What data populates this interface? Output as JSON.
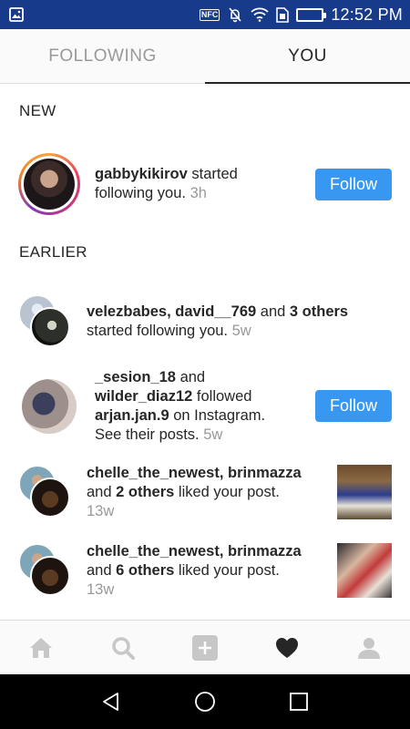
{
  "status_bar": {
    "time": "12:52 PM",
    "nfc_label": "NFC",
    "icons": [
      "gallery-icon",
      "nfc-icon",
      "vibrate-icon",
      "wifi-icon",
      "sim-icon",
      "battery-icon"
    ]
  },
  "tabs": [
    {
      "label": "FOLLOWING",
      "active": false
    },
    {
      "label": "YOU",
      "active": true
    }
  ],
  "sections": {
    "new": "NEW",
    "earlier": "EARLIER"
  },
  "notifications": {
    "n1": {
      "user": "gabbykikirov",
      "text": " started following you.",
      "time": "3h",
      "button": "Follow"
    },
    "n2": {
      "user1": "velezbabes",
      "sep": ", ",
      "user2": "david__769",
      "and": " and ",
      "others": "3 others",
      "text": " started following you.",
      "time": "5w"
    },
    "n3": {
      "user1": "_sesion_18",
      "and": " and ",
      "user2": "wilder_diaz12",
      "mid": " followed ",
      "user3": "arjan.jan.9",
      "text": " on Instagram. See their posts.",
      "time": "5w",
      "button": "Follow"
    },
    "n4": {
      "user1": "chelle_the_newest",
      "sep": ", ",
      "user2": "brinmazza",
      "and": " and ",
      "others": "2 others",
      "text": " liked your post.",
      "time": "13w"
    },
    "n5": {
      "user1": "chelle_the_newest",
      "sep": ", ",
      "user2": "brinmazza",
      "and": " and ",
      "others": "6 others",
      "text": " liked your post.",
      "time": "13w"
    }
  },
  "bottom_nav": [
    "home-icon",
    "search-icon",
    "add-icon",
    "heart-icon",
    "profile-icon"
  ],
  "android_nav": [
    "back-icon",
    "home-circle-icon",
    "recents-icon"
  ],
  "colors": {
    "follow_button": "#3897f0",
    "status_bar": "#173a8a",
    "text": "#262626",
    "muted": "#999999"
  }
}
